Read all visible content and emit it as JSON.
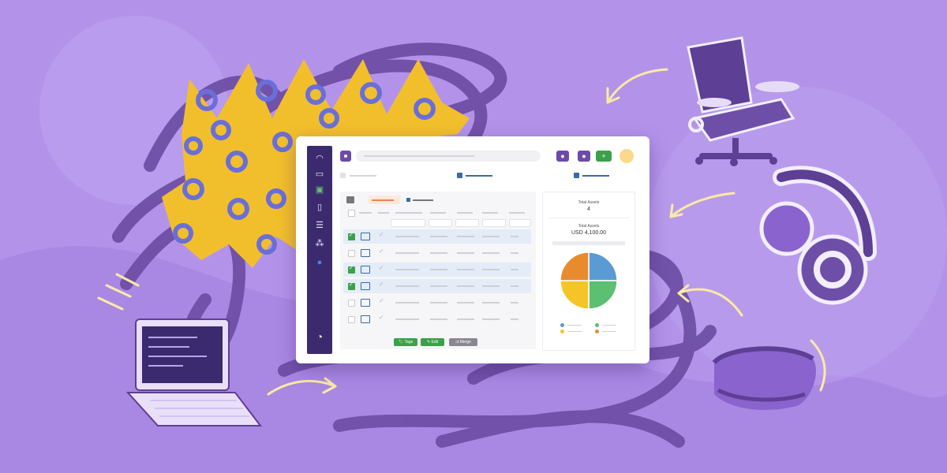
{
  "colors": {
    "background": "#b393ea",
    "scribble": "#6b4ca3",
    "yellow": "#f2bf2c",
    "ring": "#6a6fd8",
    "accent_purple": "#6d4aa8",
    "green": "#3ca04a",
    "grey_btn": "#8a8790"
  },
  "sidebar": {
    "icons": [
      "logo-icon",
      "laptop-icon",
      "monitor-icon",
      "document-icon",
      "database-icon",
      "components-icon",
      "globe-icon",
      "brand-icon"
    ]
  },
  "topbar": {
    "buttons": [
      "purple-button",
      "purple-button",
      "green-button"
    ],
    "avatar": "avatar"
  },
  "summary": {
    "total_assets_label": "Total Assets",
    "total_assets_value": "4",
    "total_cost_label": "Total Assets",
    "total_cost_value": "USD 4,100.00"
  },
  "table": {
    "rows": [
      {
        "selected": true,
        "checked": true
      },
      {
        "selected": false,
        "checked": false
      },
      {
        "selected": true,
        "checked": true
      },
      {
        "selected": true,
        "checked": true
      },
      {
        "selected": false,
        "checked": false
      },
      {
        "selected": false,
        "checked": false
      }
    ]
  },
  "footer": {
    "tags_label": "Tags",
    "edit_label": "Edit",
    "merge_label": "Merge"
  },
  "chart_data": {
    "type": "pie",
    "categories": [
      "",
      "",
      "",
      ""
    ],
    "values": [
      25,
      25,
      25,
      25
    ],
    "colors": [
      "#5a9bd4",
      "#5cbf72",
      "#f5c527",
      "#e78b2e"
    ],
    "title": ""
  }
}
